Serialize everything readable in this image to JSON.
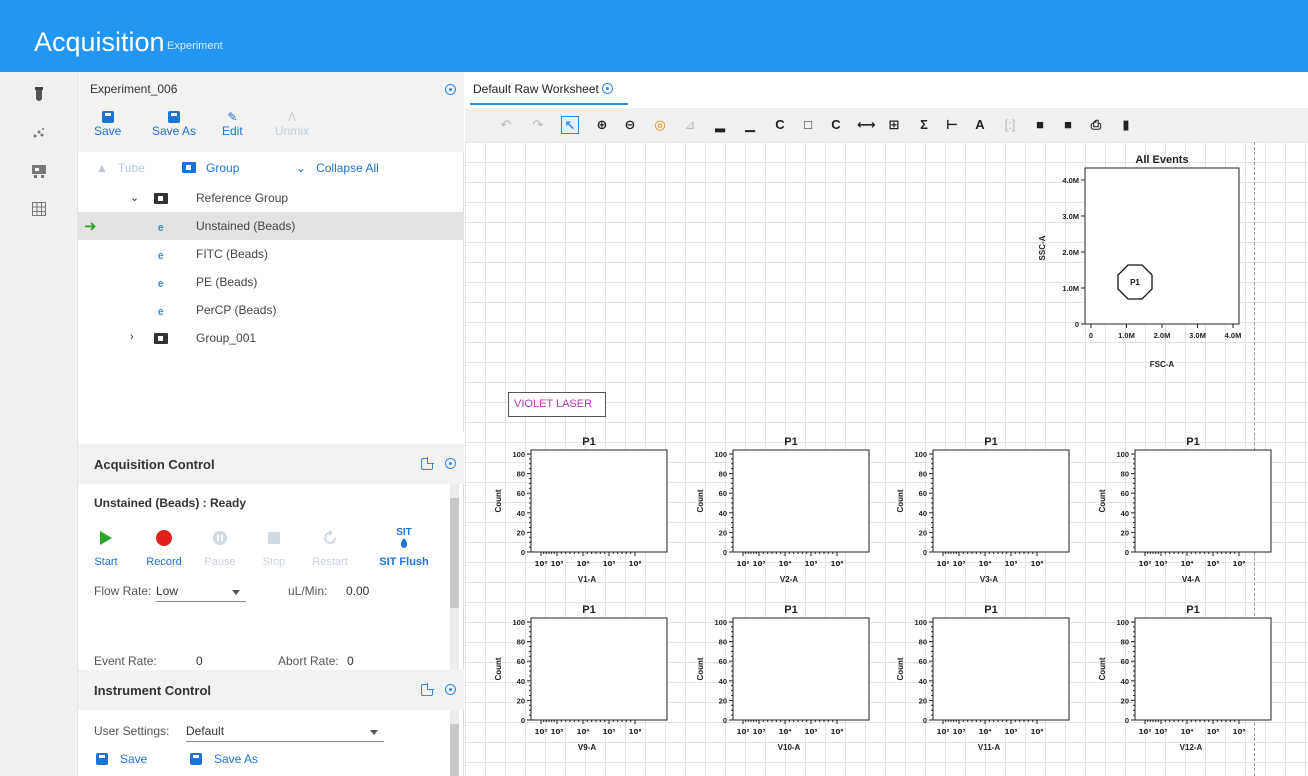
{
  "header": {
    "title": "Acquisition",
    "subtitle": "Experiment"
  },
  "rail": {
    "icons": [
      "tube-icon",
      "scatter-icon",
      "instrument-icon",
      "grid-icon"
    ]
  },
  "experiment": {
    "name": "Experiment_006",
    "toolbar": [
      {
        "label": "Save",
        "icon": "save-icon",
        "enabled": true
      },
      {
        "label": "Save As",
        "icon": "save-as-icon",
        "enabled": true
      },
      {
        "label": "Edit",
        "icon": "edit-icon",
        "enabled": true
      },
      {
        "label": "Unmix",
        "icon": "unmix-icon",
        "enabled": false
      }
    ],
    "actions": {
      "tube": "Tube",
      "group": "Group",
      "collapse_all": "Collapse All"
    },
    "tree": [
      {
        "label": "Reference Group",
        "type": "folder",
        "expanded": true
      },
      {
        "label": "Unstained (Beads)",
        "type": "tube",
        "selected": true
      },
      {
        "label": "FITC (Beads)",
        "type": "tube"
      },
      {
        "label": "PE (Beads)",
        "type": "tube"
      },
      {
        "label": "PerCP (Beads)",
        "type": "tube"
      },
      {
        "label": "Group_001",
        "type": "folder",
        "expanded": false
      }
    ]
  },
  "acquisition_control": {
    "title": "Acquisition Control",
    "status": "Unstained (Beads) : Ready",
    "controls": [
      {
        "label": "Start",
        "enabled": true
      },
      {
        "label": "Record",
        "enabled": true
      },
      {
        "label": "Pause",
        "enabled": false
      },
      {
        "label": "Stop",
        "enabled": false
      },
      {
        "label": "Restart",
        "enabled": false
      },
      {
        "label": "SIT Flush",
        "enabled": true,
        "icon_text": "SIT"
      }
    ],
    "flow_rate_label": "Flow Rate:",
    "flow_rate_value": "Low",
    "ul_min_label": "uL/Min:",
    "ul_min_value": "0.00",
    "event_rate_label": "Event Rate:",
    "event_rate_value": "0",
    "abort_rate_label": "Abort Rate:",
    "abort_rate_value": "0"
  },
  "instrument_control": {
    "title": "Instrument Control",
    "user_settings_label": "User Settings:",
    "user_settings_value": "Default",
    "save_label": "Save",
    "save_as_label": "Save As"
  },
  "worksheet": {
    "tab": "Default Raw Worksheet",
    "laser_label": "VIOLET LASER",
    "scatter": {
      "title": "All Events",
      "xlabel": "FSC-A",
      "ylabel": "SSC-A",
      "xticks": [
        "0",
        "1.0M",
        "2.0M",
        "3.0M",
        "4.0M"
      ],
      "yticks": [
        "0",
        "1.0M",
        "2.0M",
        "3.0M",
        "4.0M"
      ],
      "gate": "P1"
    },
    "histogram_common": {
      "title": "P1",
      "ylabel": "Count",
      "yticks": [
        "0",
        "20",
        "40",
        "60",
        "80",
        "100"
      ],
      "xticks": [
        "10²",
        "10³",
        "10⁴",
        "10⁵",
        "10⁶"
      ]
    },
    "histograms": [
      "V1-A",
      "V2-A",
      "V3-A",
      "V4-A",
      "V9-A",
      "V10-A",
      "V11-A",
      "V12-A"
    ]
  },
  "colors": {
    "header": "#2196f3",
    "accent": "#1e73d6",
    "start": "#2aa52a",
    "record": "#e0201b",
    "laser_text": "#b23ab6"
  }
}
